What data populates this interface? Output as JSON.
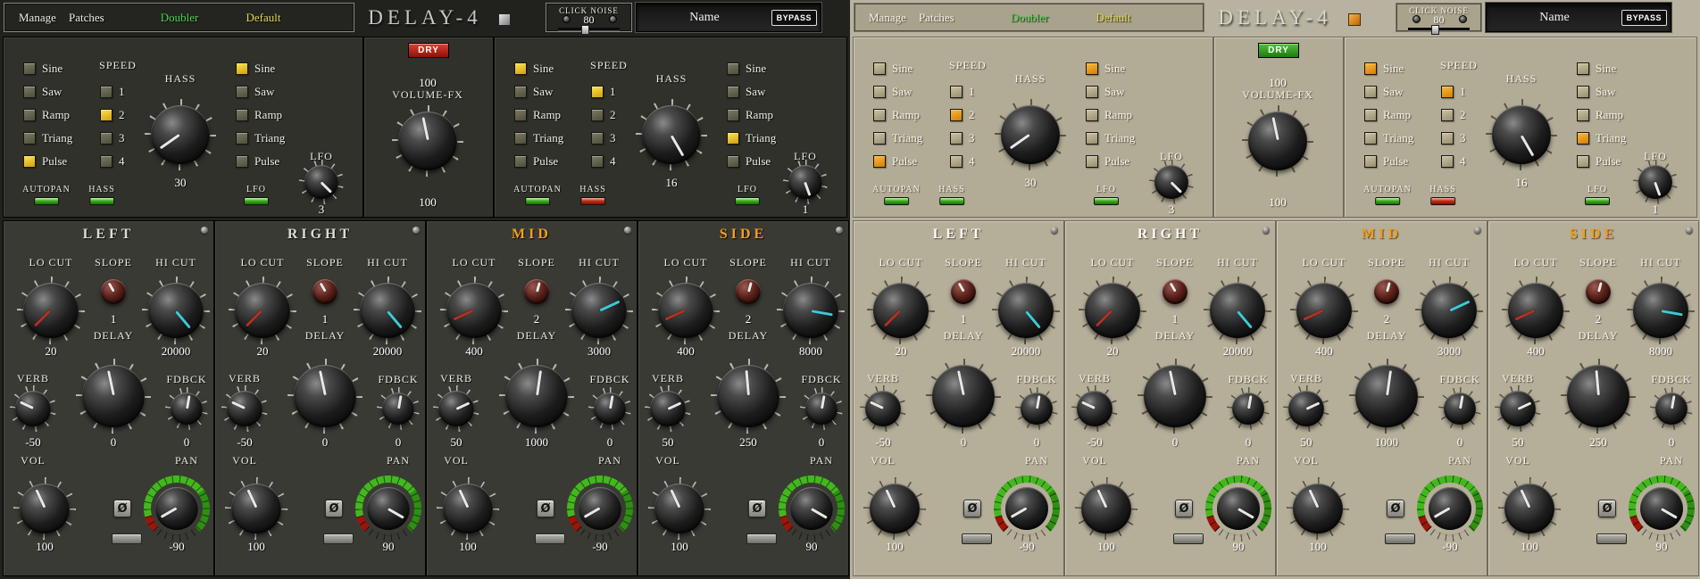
{
  "plugins": [
    {
      "theme": "dark",
      "topbar": {
        "menu": {
          "manage": "Manage",
          "patches": "Patches"
        },
        "preset_a": "Doubler",
        "preset_b": "Default",
        "title": "DELAY-4",
        "swatch": "grey",
        "click_noise": {
          "label": "CLICK NOISE",
          "value": "80"
        },
        "name_field": "Name",
        "bypass": "BYPASS"
      },
      "fx": {
        "dry_label": "DRY",
        "dry_state": "red",
        "value_top": "100",
        "volume_label": "VOLUME-FX",
        "value_bottom": "100",
        "knob_angle": -12
      },
      "lfo_panels": [
        {
          "waves1": [
            {
              "label": "Sine",
              "on": false
            },
            {
              "label": "Saw",
              "on": false
            },
            {
              "label": "Ramp",
              "on": false
            },
            {
              "label": "Triang",
              "on": false
            },
            {
              "label": "Pulse",
              "on": true
            }
          ],
          "speed_label": "SPEED",
          "speeds": [
            {
              "label": "1",
              "on": false
            },
            {
              "label": "2",
              "on": true
            },
            {
              "label": "3",
              "on": false
            },
            {
              "label": "4",
              "on": false
            }
          ],
          "hass_label": "HASS",
          "hass_value": "30",
          "hass_angle": -125,
          "waves2": [
            {
              "label": "Sine",
              "on": true
            },
            {
              "label": "Saw",
              "on": false
            },
            {
              "label": "Ramp",
              "on": false
            },
            {
              "label": "Triang",
              "on": false
            },
            {
              "label": "Pulse",
              "on": false
            }
          ],
          "lfo_label": "LFO",
          "lfo_value": "3",
          "lfo_angle": 135,
          "switches": [
            {
              "label": "AUTOPAN",
              "state": "green"
            },
            {
              "label": "HASS",
              "state": "green"
            },
            {
              "label": "LFO",
              "state": "green"
            }
          ]
        },
        {
          "waves1": [
            {
              "label": "Sine",
              "on": true
            },
            {
              "label": "Saw",
              "on": false
            },
            {
              "label": "Ramp",
              "on": false
            },
            {
              "label": "Triang",
              "on": false
            },
            {
              "label": "Pulse",
              "on": false
            }
          ],
          "speed_label": "SPEED",
          "speeds": [
            {
              "label": "1",
              "on": true
            },
            {
              "label": "2",
              "on": false
            },
            {
              "label": "3",
              "on": false
            },
            {
              "label": "4",
              "on": false
            }
          ],
          "hass_label": "HASS",
          "hass_value": "16",
          "hass_angle": 150,
          "waves2": [
            {
              "label": "Sine",
              "on": false
            },
            {
              "label": "Saw",
              "on": false
            },
            {
              "label": "Ramp",
              "on": false
            },
            {
              "label": "Triang",
              "on": true
            },
            {
              "label": "Pulse",
              "on": false
            }
          ],
          "lfo_label": "LFO",
          "lfo_value": "1",
          "lfo_angle": 160,
          "switches": [
            {
              "label": "AUTOPAN",
              "state": "green"
            },
            {
              "label": "HASS",
              "state": "red"
            },
            {
              "label": "LFO",
              "state": "green"
            }
          ]
        }
      ],
      "channels": [
        {
          "name": "LEFT",
          "accent": false,
          "locut_label": "LO CUT",
          "slope_label": "SLOPE",
          "hicut_label": "HI CUT",
          "delay_label": "DELAY",
          "verb_label": "VERB",
          "fdbck_label": "FDBCK",
          "vol_label": "VOL",
          "pan_label": "PAN",
          "phase_label": "Ø",
          "locut": "20",
          "slope": "1",
          "hicut": "20000",
          "verb": "-50",
          "delay": "0",
          "fdbck": "0",
          "vol": "100",
          "pan": "-90",
          "locut_angle": -135,
          "slope_angle": -30,
          "hicut_angle": 140,
          "verb_angle": -65,
          "delay_angle": -12,
          "fdbck_angle": 10,
          "vol_angle": -25,
          "pan_angle": -120
        },
        {
          "name": "RIGHT",
          "accent": false,
          "locut_label": "LO CUT",
          "slope_label": "SLOPE",
          "hicut_label": "HI CUT",
          "delay_label": "DELAY",
          "verb_label": "VERB",
          "fdbck_label": "FDBCK",
          "vol_label": "VOL",
          "pan_label": "PAN",
          "phase_label": "Ø",
          "locut": "20",
          "slope": "1",
          "hicut": "20000",
          "verb": "-50",
          "delay": "0",
          "fdbck": "0",
          "vol": "100",
          "pan": "90",
          "locut_angle": -135,
          "slope_angle": -30,
          "hicut_angle": 140,
          "verb_angle": -65,
          "delay_angle": -12,
          "fdbck_angle": 10,
          "vol_angle": -25,
          "pan_angle": 120
        },
        {
          "name": "MID",
          "accent": true,
          "locut_label": "LO CUT",
          "slope_label": "SLOPE",
          "hicut_label": "HI CUT",
          "delay_label": "DELAY",
          "verb_label": "VERB",
          "fdbck_label": "FDBCK",
          "vol_label": "VOL",
          "pan_label": "PAN",
          "phase_label": "Ø",
          "locut": "400",
          "slope": "2",
          "hicut": "3000",
          "verb": "50",
          "delay": "1000",
          "fdbck": "0",
          "vol": "100",
          "pan": "-90",
          "locut_angle": -115,
          "slope_angle": 15,
          "hicut_angle": 65,
          "verb_angle": 65,
          "delay_angle": 8,
          "fdbck_angle": 10,
          "vol_angle": -25,
          "pan_angle": -120
        },
        {
          "name": "SIDE",
          "accent": true,
          "locut_label": "LO CUT",
          "slope_label": "SLOPE",
          "hicut_label": "HI CUT",
          "delay_label": "DELAY",
          "verb_label": "VERB",
          "fdbck_label": "FDBCK",
          "vol_label": "VOL",
          "pan_label": "PAN",
          "phase_label": "Ø",
          "locut": "400",
          "slope": "2",
          "hicut": "8000",
          "verb": "50",
          "delay": "250",
          "fdbck": "0",
          "vol": "100",
          "pan": "90",
          "locut_angle": -115,
          "slope_angle": 15,
          "hicut_angle": 100,
          "verb_angle": 65,
          "delay_angle": -5,
          "fdbck_angle": 10,
          "vol_angle": -25,
          "pan_angle": 120
        }
      ]
    },
    {
      "theme": "light",
      "topbar": {
        "menu": {
          "manage": "Manage",
          "patches": "Patches"
        },
        "preset_a": "Doubler",
        "preset_b": "Default",
        "title": "DELAY-4",
        "swatch": "orange",
        "click_noise": {
          "label": "CLICK NOISE",
          "value": "80"
        },
        "name_field": "Name",
        "bypass": "BYPASS"
      },
      "fx": {
        "dry_label": "DRY",
        "dry_state": "green",
        "value_top": "100",
        "volume_label": "VOLUME-FX",
        "value_bottom": "100",
        "knob_angle": -12
      },
      "lfo_panels": [
        {
          "waves1": [
            {
              "label": "Sine",
              "on": false
            },
            {
              "label": "Saw",
              "on": false
            },
            {
              "label": "Ramp",
              "on": false
            },
            {
              "label": "Triang",
              "on": false
            },
            {
              "label": "Pulse",
              "on": true
            }
          ],
          "speed_label": "SPEED",
          "speeds": [
            {
              "label": "1",
              "on": false
            },
            {
              "label": "2",
              "on": true
            },
            {
              "label": "3",
              "on": false
            },
            {
              "label": "4",
              "on": false
            }
          ],
          "hass_label": "HASS",
          "hass_value": "30",
          "hass_angle": -125,
          "waves2": [
            {
              "label": "Sine",
              "on": true
            },
            {
              "label": "Saw",
              "on": false
            },
            {
              "label": "Ramp",
              "on": false
            },
            {
              "label": "Triang",
              "on": false
            },
            {
              "label": "Pulse",
              "on": false
            }
          ],
          "lfo_label": "LFO",
          "lfo_value": "3",
          "lfo_angle": 135,
          "switches": [
            {
              "label": "AUTOPAN",
              "state": "green"
            },
            {
              "label": "HASS",
              "state": "green"
            },
            {
              "label": "LFO",
              "state": "green"
            }
          ]
        },
        {
          "waves1": [
            {
              "label": "Sine",
              "on": true
            },
            {
              "label": "Saw",
              "on": false
            },
            {
              "label": "Ramp",
              "on": false
            },
            {
              "label": "Triang",
              "on": false
            },
            {
              "label": "Pulse",
              "on": false
            }
          ],
          "speed_label": "SPEED",
          "speeds": [
            {
              "label": "1",
              "on": true
            },
            {
              "label": "2",
              "on": false
            },
            {
              "label": "3",
              "on": false
            },
            {
              "label": "4",
              "on": false
            }
          ],
          "hass_label": "HASS",
          "hass_value": "16",
          "hass_angle": 150,
          "waves2": [
            {
              "label": "Sine",
              "on": false
            },
            {
              "label": "Saw",
              "on": false
            },
            {
              "label": "Ramp",
              "on": false
            },
            {
              "label": "Triang",
              "on": true
            },
            {
              "label": "Pulse",
              "on": false
            }
          ],
          "lfo_label": "LFO",
          "lfo_value": "1",
          "lfo_angle": 160,
          "switches": [
            {
              "label": "AUTOPAN",
              "state": "green"
            },
            {
              "label": "HASS",
              "state": "red"
            },
            {
              "label": "LFO",
              "state": "green"
            }
          ]
        }
      ],
      "channels": [
        {
          "name": "LEFT",
          "accent": false,
          "locut_label": "LO CUT",
          "slope_label": "SLOPE",
          "hicut_label": "HI CUT",
          "delay_label": "DELAY",
          "verb_label": "VERB",
          "fdbck_label": "FDBCK",
          "vol_label": "VOL",
          "pan_label": "PAN",
          "phase_label": "Ø",
          "locut": "20",
          "slope": "1",
          "hicut": "20000",
          "verb": "-50",
          "delay": "0",
          "fdbck": "0",
          "vol": "100",
          "pan": "-90",
          "locut_angle": -135,
          "slope_angle": -30,
          "hicut_angle": 140,
          "verb_angle": -65,
          "delay_angle": -12,
          "fdbck_angle": 10,
          "vol_angle": -25,
          "pan_angle": -120
        },
        {
          "name": "RIGHT",
          "accent": false,
          "locut_label": "LO CUT",
          "slope_label": "SLOPE",
          "hicut_label": "HI CUT",
          "delay_label": "DELAY",
          "verb_label": "VERB",
          "fdbck_label": "FDBCK",
          "vol_label": "VOL",
          "pan_label": "PAN",
          "phase_label": "Ø",
          "locut": "20",
          "slope": "1",
          "hicut": "20000",
          "verb": "-50",
          "delay": "0",
          "fdbck": "0",
          "vol": "100",
          "pan": "90",
          "locut_angle": -135,
          "slope_angle": -30,
          "hicut_angle": 140,
          "verb_angle": -65,
          "delay_angle": -12,
          "fdbck_angle": 10,
          "vol_angle": -25,
          "pan_angle": 120
        },
        {
          "name": "MID",
          "accent": true,
          "locut_label": "LO CUT",
          "slope_label": "SLOPE",
          "hicut_label": "HI CUT",
          "delay_label": "DELAY",
          "verb_label": "VERB",
          "fdbck_label": "FDBCK",
          "vol_label": "VOL",
          "pan_label": "PAN",
          "phase_label": "Ø",
          "locut": "400",
          "slope": "2",
          "hicut": "3000",
          "verb": "50",
          "delay": "1000",
          "fdbck": "0",
          "vol": "100",
          "pan": "-90",
          "locut_angle": -115,
          "slope_angle": 15,
          "hicut_angle": 65,
          "verb_angle": 65,
          "delay_angle": 8,
          "fdbck_angle": 10,
          "vol_angle": -25,
          "pan_angle": -120
        },
        {
          "name": "SIDE",
          "accent": true,
          "locut_label": "LO CUT",
          "slope_label": "SLOPE",
          "hicut_label": "HI CUT",
          "delay_label": "DELAY",
          "verb_label": "VERB",
          "fdbck_label": "FDBCK",
          "vol_label": "VOL",
          "pan_label": "PAN",
          "phase_label": "Ø",
          "locut": "400",
          "slope": "2",
          "hicut": "8000",
          "verb": "50",
          "delay": "250",
          "fdbck": "0",
          "vol": "100",
          "pan": "90",
          "locut_angle": -115,
          "slope_angle": 15,
          "hicut_angle": 100,
          "verb_angle": 65,
          "delay_angle": -5,
          "fdbck_angle": 10,
          "vol_angle": -25,
          "pan_angle": 120
        }
      ]
    }
  ]
}
